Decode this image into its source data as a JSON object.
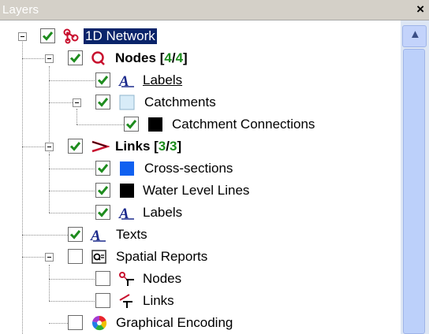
{
  "panel": {
    "title": "Layers",
    "close_glyph": "×"
  },
  "tree": {
    "root": {
      "label": "1D Network",
      "checked": true,
      "icon": "network-icon"
    },
    "nodes": {
      "label_prefix": "Nodes ",
      "label_bracket_open": "[",
      "count_a": "4",
      "slash": "/",
      "count_b": "4",
      "label_bracket_close": "]",
      "checked": true,
      "icon": "node-circle-icon"
    },
    "node_labels": {
      "label": "Labels",
      "checked": true,
      "icon": "text-a-icon"
    },
    "catchments": {
      "label": "Catchments",
      "checked": true,
      "icon": "light-blue-square-icon",
      "swatch": "#d8ecf8"
    },
    "catchment_connections": {
      "label": "Catchment Connections",
      "checked": true,
      "icon": "black-square-icon",
      "swatch": "#000000"
    },
    "links": {
      "label_prefix": "Links ",
      "label_bracket_open": "[",
      "count_a": "3",
      "slash": "/",
      "count_b": "3",
      "label_bracket_close": "]",
      "checked": true,
      "icon": "link-icon"
    },
    "cross_sections": {
      "label": "Cross-sections",
      "checked": true,
      "icon": "blue-square-icon",
      "swatch": "#1060f0"
    },
    "water_level_lines": {
      "label": "Water Level Lines",
      "checked": true,
      "icon": "black-square-icon",
      "swatch": "#000000"
    },
    "link_labels": {
      "label": "Labels",
      "checked": true,
      "icon": "text-a-icon"
    },
    "texts": {
      "label": "Texts",
      "checked": true,
      "icon": "text-a-icon"
    },
    "spatial_reports": {
      "label": "Spatial Reports",
      "checked": false,
      "icon": "report-icon"
    },
    "sr_nodes": {
      "label": "Nodes",
      "checked": false,
      "icon": "node-pin-icon"
    },
    "sr_links": {
      "label": "Links",
      "checked": false,
      "icon": "link-pin-icon"
    },
    "graphical_encoding": {
      "label": "Graphical Encoding",
      "checked": false,
      "icon": "color-wheel-icon"
    }
  },
  "colors": {
    "selection": "#0a246a",
    "check": "#1e8c1e",
    "count": "#1e8c1e"
  }
}
